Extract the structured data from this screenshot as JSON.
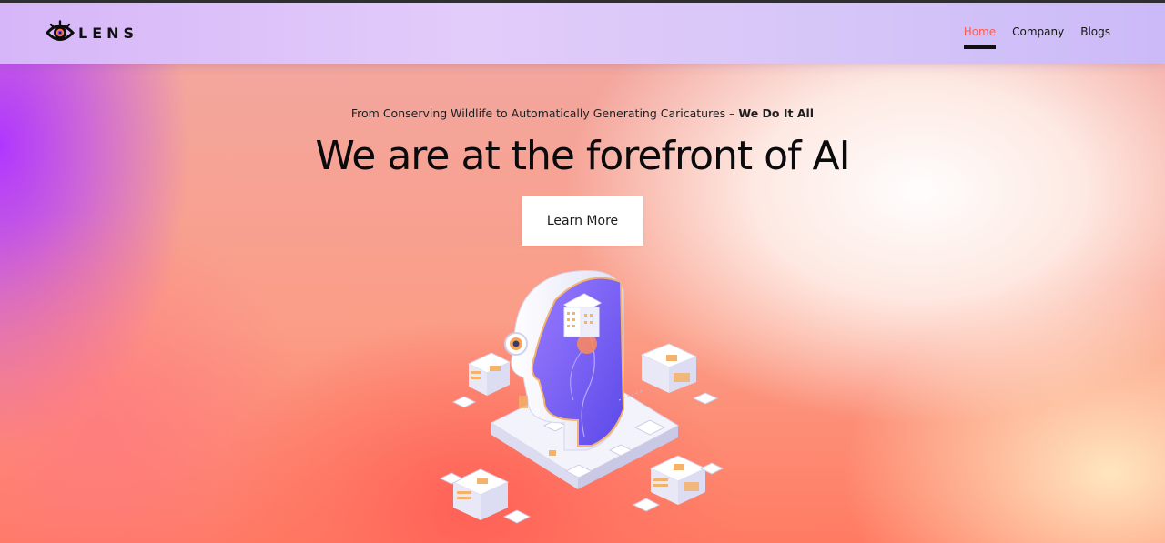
{
  "brand": {
    "name": "LENS",
    "logo_icon": "eye-icon"
  },
  "nav": {
    "items": [
      {
        "label": "Home",
        "active": true
      },
      {
        "label": "Company",
        "active": false
      },
      {
        "label": "Blogs",
        "active": false
      }
    ]
  },
  "hero": {
    "tagline_lead": "From Conserving Wildlife to Automatically Generating Caricatures – ",
    "tagline_bold": "We Do It All",
    "headline": "We are at the forefront of AI",
    "cta_label": "Learn More"
  },
  "colors": {
    "accent": "#ff5a4e",
    "nav_bg": "#dcc4f8",
    "purple_edge": "#b038ff",
    "coral": "#ff6a55"
  },
  "illustration": {
    "name": "ai-head-isometric-illustration"
  }
}
